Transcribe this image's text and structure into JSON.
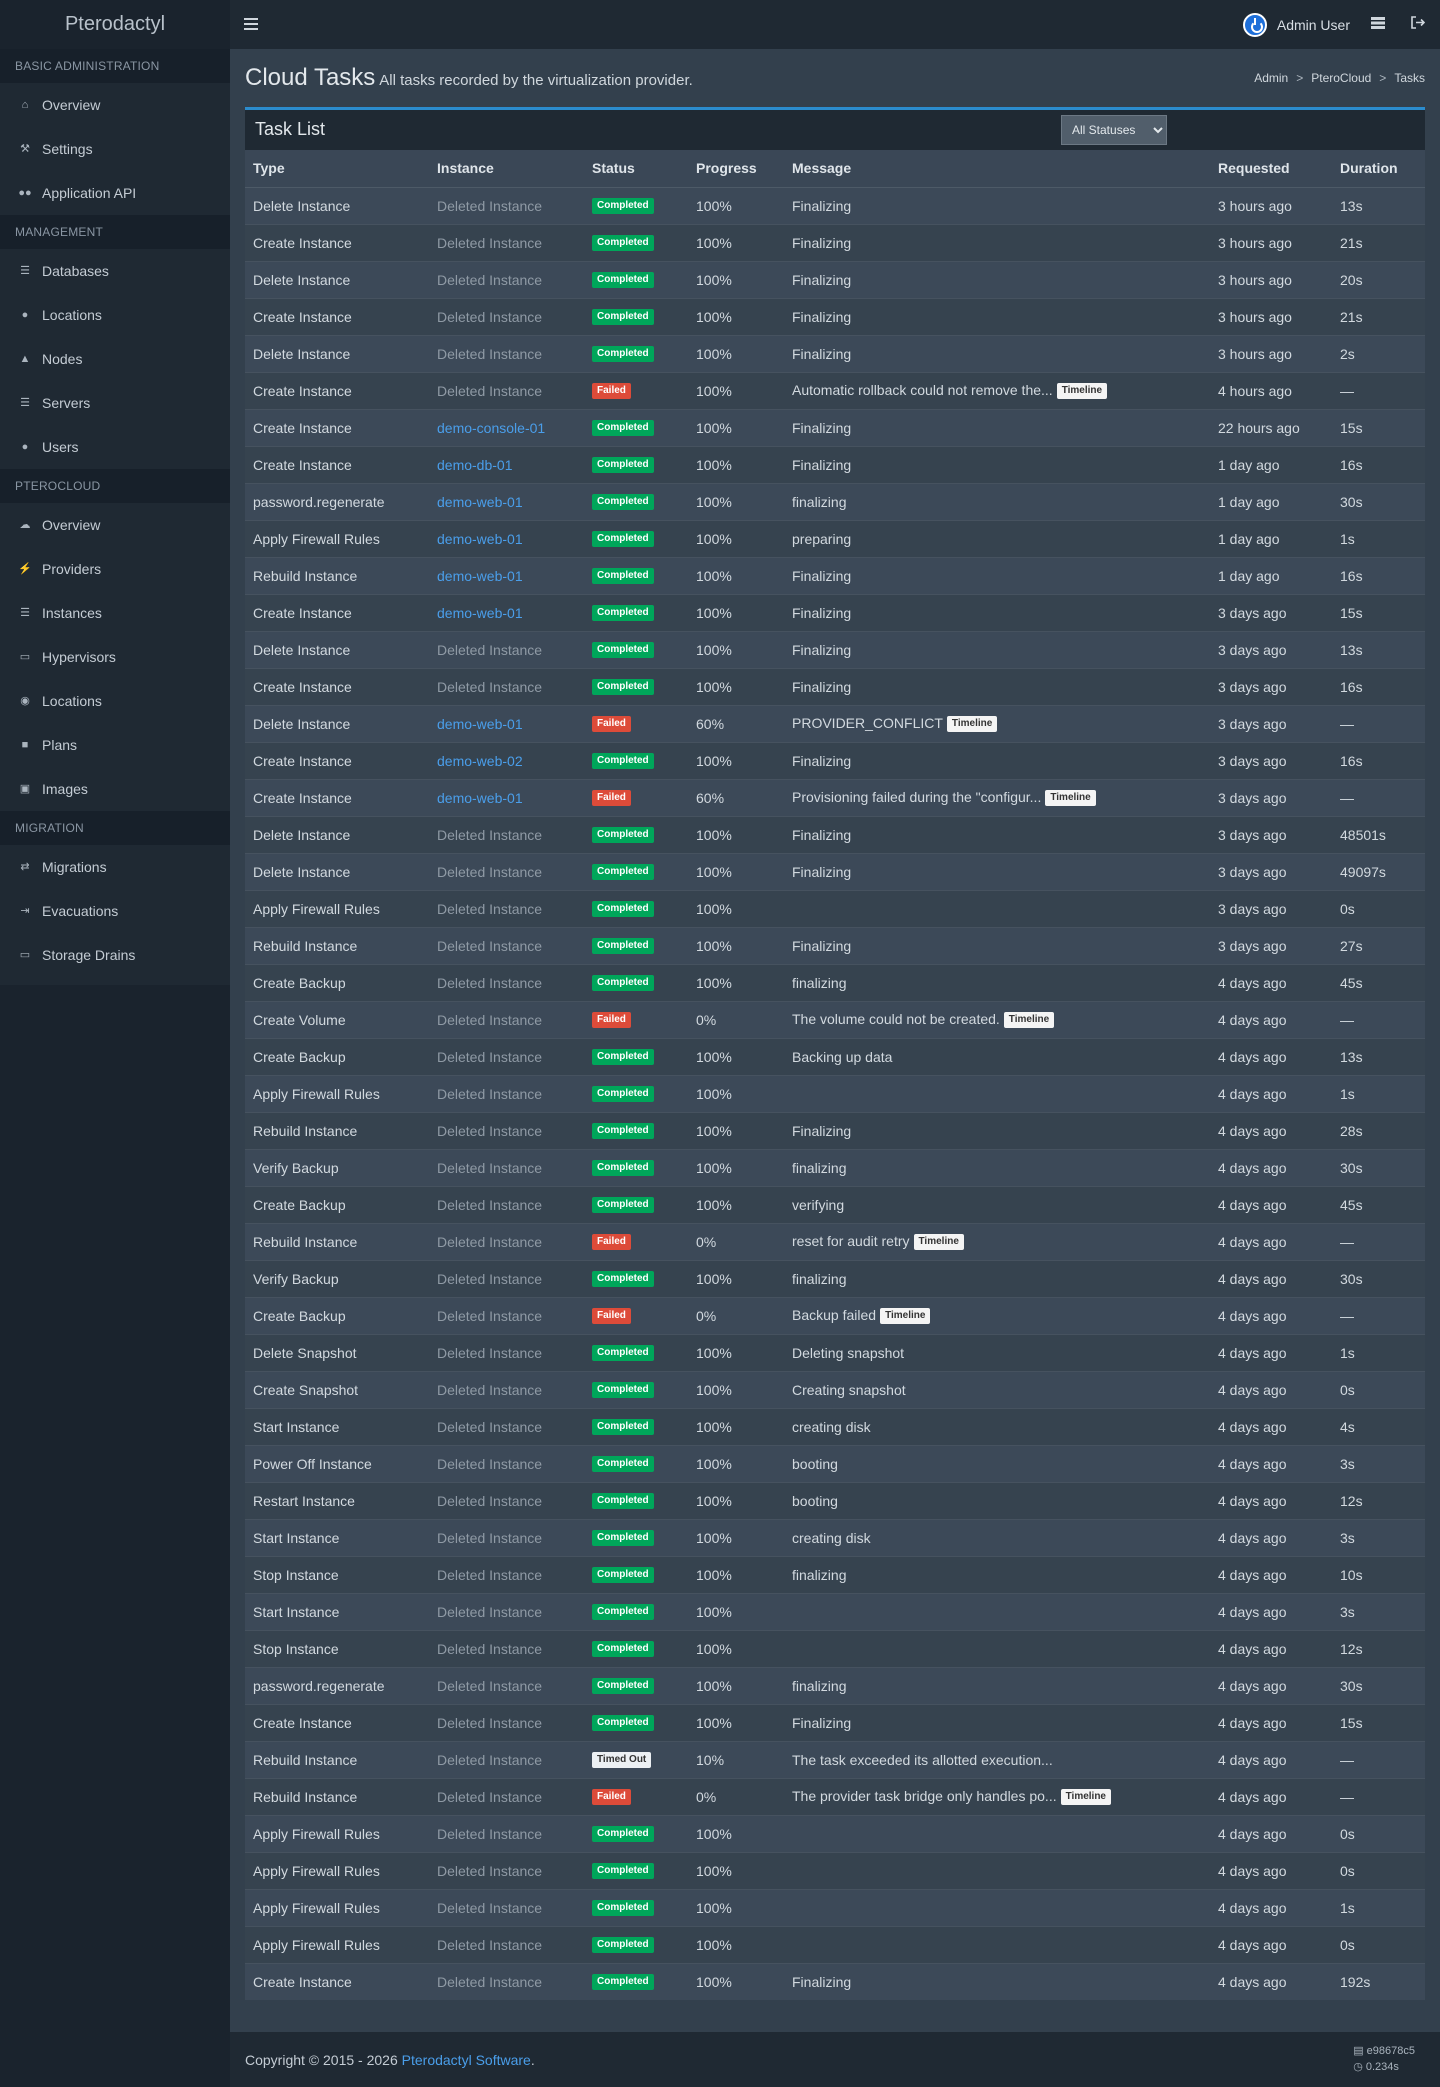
{
  "app": {
    "brand": "Pterodactyl"
  },
  "header": {
    "user_name": "Admin User",
    "icons": [
      "menu-icon",
      "user-avatar-icon",
      "server-list-icon",
      "logout-icon"
    ]
  },
  "sidebar": {
    "sections": [
      {
        "header": "Basic Administration",
        "items": [
          {
            "label": "Overview",
            "icon": "home-icon"
          },
          {
            "label": "Settings",
            "icon": "wrench-icon"
          },
          {
            "label": "Application API",
            "icon": "gamepad-icon"
          }
        ]
      },
      {
        "header": "Management",
        "items": [
          {
            "label": "Databases",
            "icon": "database-icon"
          },
          {
            "label": "Locations",
            "icon": "globe-icon"
          },
          {
            "label": "Nodes",
            "icon": "sitemap-icon"
          },
          {
            "label": "Servers",
            "icon": "server-icon"
          },
          {
            "label": "Users",
            "icon": "users-icon"
          }
        ]
      },
      {
        "header": "PteroCloud",
        "items": [
          {
            "label": "Overview",
            "icon": "cloud-icon"
          },
          {
            "label": "Providers",
            "icon": "plug-icon"
          },
          {
            "label": "Instances",
            "icon": "server-icon"
          },
          {
            "label": "Hypervisors",
            "icon": "desktop-icon"
          },
          {
            "label": "Locations",
            "icon": "map-pin-icon"
          },
          {
            "label": "Plans",
            "icon": "cube-icon"
          },
          {
            "label": "Images",
            "icon": "image-icon"
          }
        ]
      },
      {
        "header": "Migration",
        "items": [
          {
            "label": "Migrations",
            "icon": "exchange-icon"
          },
          {
            "label": "Evacuations",
            "icon": "sign-out-icon"
          },
          {
            "label": "Storage Drains",
            "icon": "hdd-icon"
          }
        ]
      }
    ]
  },
  "page": {
    "title": "Cloud Tasks",
    "subtitle": "All tasks recorded by the virtualization provider.",
    "breadcrumb": [
      "Admin",
      "PteroCloud",
      "Tasks"
    ]
  },
  "task_list": {
    "title": "Task List",
    "filter_value": "All Statuses",
    "timeline_label": "Timeline",
    "columns": [
      "Type",
      "Instance",
      "Status",
      "Progress",
      "Message",
      "Requested",
      "Duration"
    ],
    "rows": [
      [
        "Delete Instance",
        "Deleted Instance",
        "Completed",
        "100%",
        "Finalizing",
        "3 hours ago",
        "13s",
        false
      ],
      [
        "Create Instance",
        "Deleted Instance",
        "Completed",
        "100%",
        "Finalizing",
        "3 hours ago",
        "21s",
        false
      ],
      [
        "Delete Instance",
        "Deleted Instance",
        "Completed",
        "100%",
        "Finalizing",
        "3 hours ago",
        "20s",
        false
      ],
      [
        "Create Instance",
        "Deleted Instance",
        "Completed",
        "100%",
        "Finalizing",
        "3 hours ago",
        "21s",
        false
      ],
      [
        "Delete Instance",
        "Deleted Instance",
        "Completed",
        "100%",
        "Finalizing",
        "3 hours ago",
        "2s",
        false
      ],
      [
        "Create Instance",
        "Deleted Instance",
        "Failed",
        "100%",
        "Automatic rollback could not remove the...",
        "4 hours ago",
        "—",
        true
      ],
      [
        "Create Instance",
        "demo-console-01",
        "Completed",
        "100%",
        "Finalizing",
        "22 hours ago",
        "15s",
        false
      ],
      [
        "Create Instance",
        "demo-db-01",
        "Completed",
        "100%",
        "Finalizing",
        "1 day ago",
        "16s",
        false
      ],
      [
        "password.regenerate",
        "demo-web-01",
        "Completed",
        "100%",
        "finalizing",
        "1 day ago",
        "30s",
        false
      ],
      [
        "Apply Firewall Rules",
        "demo-web-01",
        "Completed",
        "100%",
        "preparing",
        "1 day ago",
        "1s",
        false
      ],
      [
        "Rebuild Instance",
        "demo-web-01",
        "Completed",
        "100%",
        "Finalizing",
        "1 day ago",
        "16s",
        false
      ],
      [
        "Create Instance",
        "demo-web-01",
        "Completed",
        "100%",
        "Finalizing",
        "3 days ago",
        "15s",
        false
      ],
      [
        "Delete Instance",
        "Deleted Instance",
        "Completed",
        "100%",
        "Finalizing",
        "3 days ago",
        "13s",
        false
      ],
      [
        "Create Instance",
        "Deleted Instance",
        "Completed",
        "100%",
        "Finalizing",
        "3 days ago",
        "16s",
        false
      ],
      [
        "Delete Instance",
        "demo-web-01",
        "Failed",
        "60%",
        "PROVIDER_CONFLICT",
        "3 days ago",
        "—",
        true
      ],
      [
        "Create Instance",
        "demo-web-02",
        "Completed",
        "100%",
        "Finalizing",
        "3 days ago",
        "16s",
        false
      ],
      [
        "Create Instance",
        "demo-web-01",
        "Failed",
        "60%",
        "Provisioning failed during the \"configur...",
        "3 days ago",
        "—",
        true
      ],
      [
        "Delete Instance",
        "Deleted Instance",
        "Completed",
        "100%",
        "Finalizing",
        "3 days ago",
        "48501s",
        false
      ],
      [
        "Delete Instance",
        "Deleted Instance",
        "Completed",
        "100%",
        "Finalizing",
        "3 days ago",
        "49097s",
        false
      ],
      [
        "Apply Firewall Rules",
        "Deleted Instance",
        "Completed",
        "100%",
        "",
        "3 days ago",
        "0s",
        false
      ],
      [
        "Rebuild Instance",
        "Deleted Instance",
        "Completed",
        "100%",
        "Finalizing",
        "3 days ago",
        "27s",
        false
      ],
      [
        "Create Backup",
        "Deleted Instance",
        "Completed",
        "100%",
        "finalizing",
        "4 days ago",
        "45s",
        false
      ],
      [
        "Create Volume",
        "Deleted Instance",
        "Failed",
        "0%",
        "The volume could not be created.",
        "4 days ago",
        "—",
        true
      ],
      [
        "Create Backup",
        "Deleted Instance",
        "Completed",
        "100%",
        "Backing up data",
        "4 days ago",
        "13s",
        false
      ],
      [
        "Apply Firewall Rules",
        "Deleted Instance",
        "Completed",
        "100%",
        "",
        "4 days ago",
        "1s",
        false
      ],
      [
        "Rebuild Instance",
        "Deleted Instance",
        "Completed",
        "100%",
        "Finalizing",
        "4 days ago",
        "28s",
        false
      ],
      [
        "Verify Backup",
        "Deleted Instance",
        "Completed",
        "100%",
        "finalizing",
        "4 days ago",
        "30s",
        false
      ],
      [
        "Create Backup",
        "Deleted Instance",
        "Completed",
        "100%",
        "verifying",
        "4 days ago",
        "45s",
        false
      ],
      [
        "Rebuild Instance",
        "Deleted Instance",
        "Failed",
        "0%",
        "reset for audit retry",
        "4 days ago",
        "—",
        true
      ],
      [
        "Verify Backup",
        "Deleted Instance",
        "Completed",
        "100%",
        "finalizing",
        "4 days ago",
        "30s",
        false
      ],
      [
        "Create Backup",
        "Deleted Instance",
        "Failed",
        "0%",
        "Backup failed",
        "4 days ago",
        "—",
        true
      ],
      [
        "Delete Snapshot",
        "Deleted Instance",
        "Completed",
        "100%",
        "Deleting snapshot",
        "4 days ago",
        "1s",
        false
      ],
      [
        "Create Snapshot",
        "Deleted Instance",
        "Completed",
        "100%",
        "Creating snapshot",
        "4 days ago",
        "0s",
        false
      ],
      [
        "Start Instance",
        "Deleted Instance",
        "Completed",
        "100%",
        "creating disk",
        "4 days ago",
        "4s",
        false
      ],
      [
        "Power Off Instance",
        "Deleted Instance",
        "Completed",
        "100%",
        "booting",
        "4 days ago",
        "3s",
        false
      ],
      [
        "Restart Instance",
        "Deleted Instance",
        "Completed",
        "100%",
        "booting",
        "4 days ago",
        "12s",
        false
      ],
      [
        "Start Instance",
        "Deleted Instance",
        "Completed",
        "100%",
        "creating disk",
        "4 days ago",
        "3s",
        false
      ],
      [
        "Stop Instance",
        "Deleted Instance",
        "Completed",
        "100%",
        "finalizing",
        "4 days ago",
        "10s",
        false
      ],
      [
        "Start Instance",
        "Deleted Instance",
        "Completed",
        "100%",
        "",
        "4 days ago",
        "3s",
        false
      ],
      [
        "Stop Instance",
        "Deleted Instance",
        "Completed",
        "100%",
        "",
        "4 days ago",
        "12s",
        false
      ],
      [
        "password.regenerate",
        "Deleted Instance",
        "Completed",
        "100%",
        "finalizing",
        "4 days ago",
        "30s",
        false
      ],
      [
        "Create Instance",
        "Deleted Instance",
        "Completed",
        "100%",
        "Finalizing",
        "4 days ago",
        "15s",
        false
      ],
      [
        "Rebuild Instance",
        "Deleted Instance",
        "Timed Out",
        "10%",
        "The task exceeded its allotted execution...",
        "4 days ago",
        "—",
        false
      ],
      [
        "Rebuild Instance",
        "Deleted Instance",
        "Failed",
        "0%",
        "The provider task bridge only handles po...",
        "4 days ago",
        "—",
        true
      ],
      [
        "Apply Firewall Rules",
        "Deleted Instance",
        "Completed",
        "100%",
        "",
        "4 days ago",
        "0s",
        false
      ],
      [
        "Apply Firewall Rules",
        "Deleted Instance",
        "Completed",
        "100%",
        "",
        "4 days ago",
        "0s",
        false
      ],
      [
        "Apply Firewall Rules",
        "Deleted Instance",
        "Completed",
        "100%",
        "",
        "4 days ago",
        "1s",
        false
      ],
      [
        "Apply Firewall Rules",
        "Deleted Instance",
        "Completed",
        "100%",
        "",
        "4 days ago",
        "0s",
        false
      ],
      [
        "Create Instance",
        "Deleted Instance",
        "Completed",
        "100%",
        "Finalizing",
        "4 days ago",
        "192s",
        false
      ]
    ]
  },
  "footer": {
    "copyright": "Copyright © 2015 - 2026",
    "link_text": "Pterodactyl Software",
    "period": ".",
    "version": "e98678c5",
    "render_time": "0.234s"
  },
  "colors": {
    "accent": "#2b8ccd",
    "link": "#4a9eea",
    "completed": "#00a65a",
    "failed": "#dd4b39"
  }
}
